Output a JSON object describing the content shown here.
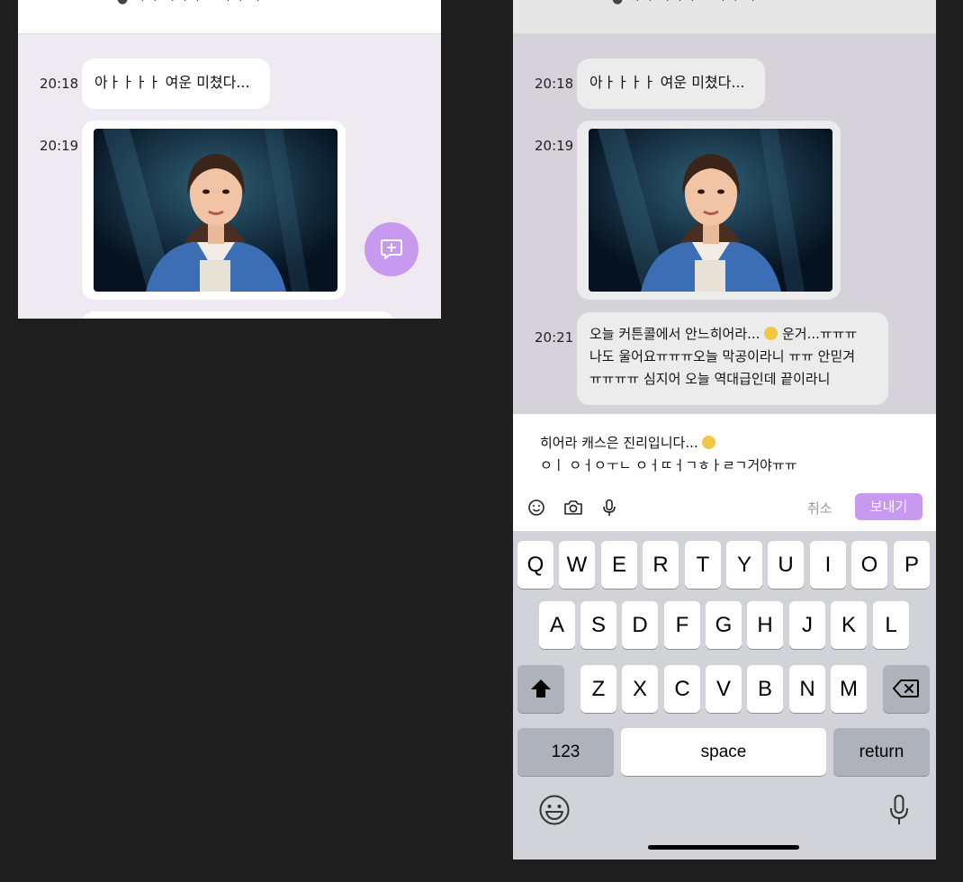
{
  "header": {
    "title_fragment": "● ㄱㄱ ㄱㄱㄱ  • ㄱㄱ ㄱ"
  },
  "left_screen": {
    "messages": [
      {
        "time": "20:18",
        "text": "아ㅏㅏㅏㅏ 여운 미쳤다..."
      },
      {
        "time": "20:19"
      }
    ]
  },
  "right_screen": {
    "messages": [
      {
        "time": "20:18",
        "text": "아ㅏㅏㅏㅏ 여운 미쳤다..."
      },
      {
        "time": "20:19"
      },
      {
        "time": "20:21",
        "line1a": "오늘 커튼콜에서 안느히어라... ",
        "line1b": " 운거...ㅠㅠㅠ",
        "line2": "나도 울어요ㅠㅠㅠ오늘 막공이라니 ㅠㅠ 안믿겨",
        "line3": "ㅠㅠㅠㅠ  심지어 오늘 역대급인데 끝이라니"
      }
    ],
    "composer": {
      "line1": "히어라 캐스은 진리입니다... ",
      "line2": "ㅇㅣ ㅇㅓㅇㅜㄴ ㅇㅓㄸㅓㄱㅎㅏㄹㄱ거야ㅠㅠ",
      "cancel_label": "취소",
      "send_label": "보내기"
    },
    "keyboard": {
      "row1": [
        "Q",
        "W",
        "E",
        "R",
        "T",
        "Y",
        "U",
        "I",
        "O",
        "P"
      ],
      "row2": [
        "A",
        "S",
        "D",
        "F",
        "G",
        "H",
        "J",
        "K",
        "L"
      ],
      "row3": [
        "Z",
        "X",
        "C",
        "V",
        "B",
        "N",
        "M"
      ],
      "numbers_label": "123",
      "space_label": "space",
      "return_label": "return"
    }
  },
  "colors": {
    "accent": "#c79af0",
    "page_bg": "#1e1e1e"
  },
  "icons": [
    "emoji-icon",
    "camera-icon",
    "mic-icon",
    "add-comment-icon",
    "shift-icon",
    "delete-icon",
    "emoji-keyboard-icon",
    "dictation-mic-icon"
  ]
}
